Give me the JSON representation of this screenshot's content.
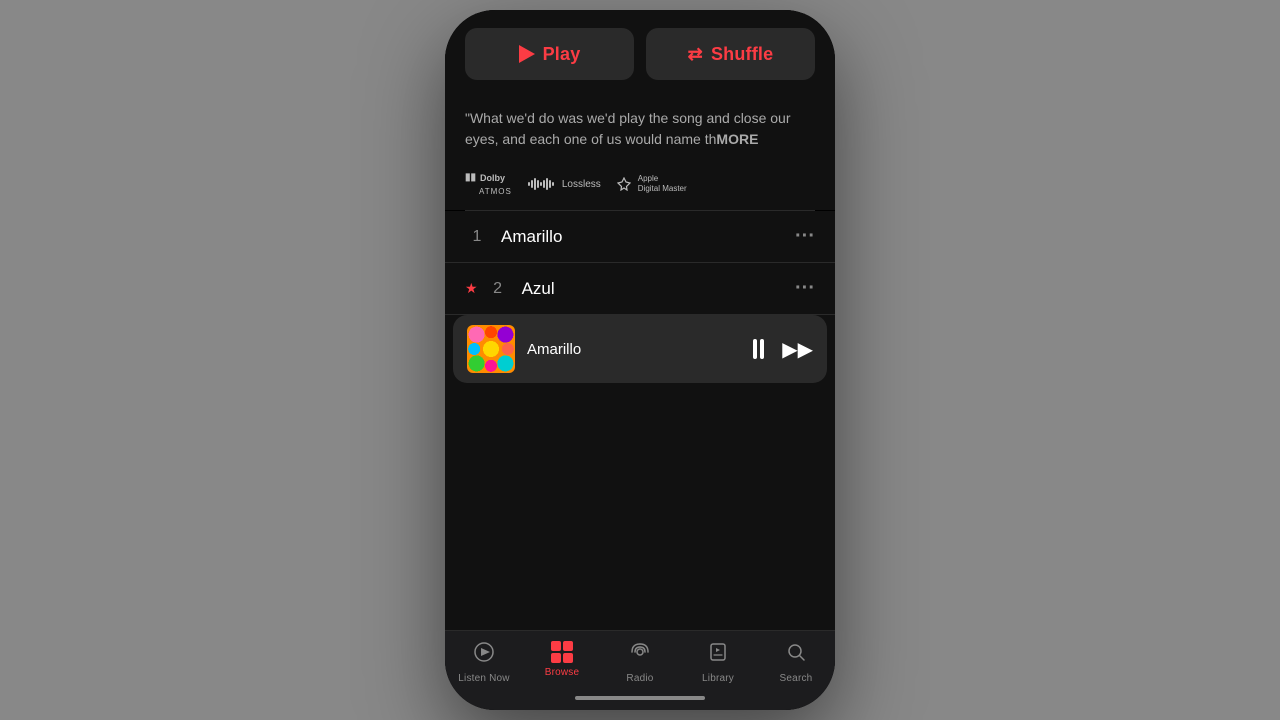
{
  "phone": {
    "buttons": {
      "play_label": "Play",
      "shuffle_label": "Shuffle"
    },
    "quote": {
      "text": "\"What we'd do was we'd play the song and close our eyes, and each one of us would name th",
      "more": "MORE"
    },
    "badges": [
      {
        "id": "dolby",
        "line1": "Dolby",
        "line2": "ATMOS"
      },
      {
        "id": "lossless",
        "label": "Lossless"
      },
      {
        "id": "adm",
        "line1": "Apple",
        "line2": "Digital Master"
      }
    ],
    "tracks": [
      {
        "number": "1",
        "name": "Amarillo",
        "starred": false
      },
      {
        "number": "2",
        "name": "Azul",
        "starred": true
      }
    ],
    "now_playing": {
      "title": "Amarillo"
    },
    "tabs": [
      {
        "id": "listen-now",
        "label": "Listen Now",
        "active": false
      },
      {
        "id": "browse",
        "label": "Browse",
        "active": true
      },
      {
        "id": "radio",
        "label": "Radio",
        "active": false
      },
      {
        "id": "library",
        "label": "Library",
        "active": false
      },
      {
        "id": "search",
        "label": "Search",
        "active": false
      }
    ]
  }
}
